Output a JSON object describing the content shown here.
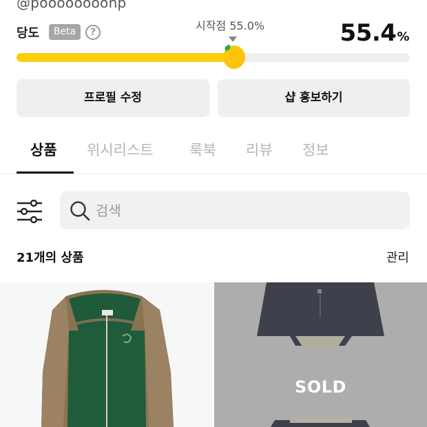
{
  "profile": {
    "handle": "@poooooooonp"
  },
  "sweetness": {
    "label": "당도",
    "badge": "Beta",
    "help_icon": "question-circle-icon",
    "start_label": "시작점 55.0%",
    "start_value": 55.0,
    "current_value": "55.4",
    "current_unit": "%",
    "level": 55.4,
    "bar_color": "#fccf0a",
    "knob_icon": "apple-icon"
  },
  "buttons": {
    "edit_profile": "프로필 수정",
    "promote_shop": "샵 홍보하기"
  },
  "tabs": [
    {
      "label": "상품",
      "active": true
    },
    {
      "label": "위시리스트",
      "active": false
    },
    {
      "label": "룩북",
      "active": false
    },
    {
      "label": "리뷰",
      "active": false
    },
    {
      "label": "정보",
      "active": false
    }
  ],
  "search": {
    "placeholder": "검색",
    "filter_icon": "sliders-icon",
    "search_icon": "search-icon"
  },
  "listing": {
    "count_label": "21개의 상품",
    "manage_label": "관리"
  },
  "products": [
    {
      "name": "green-zip-hoodie",
      "sold": false
    },
    {
      "name": "navy-skirt",
      "sold": true,
      "sold_label": "SOLD"
    }
  ]
}
